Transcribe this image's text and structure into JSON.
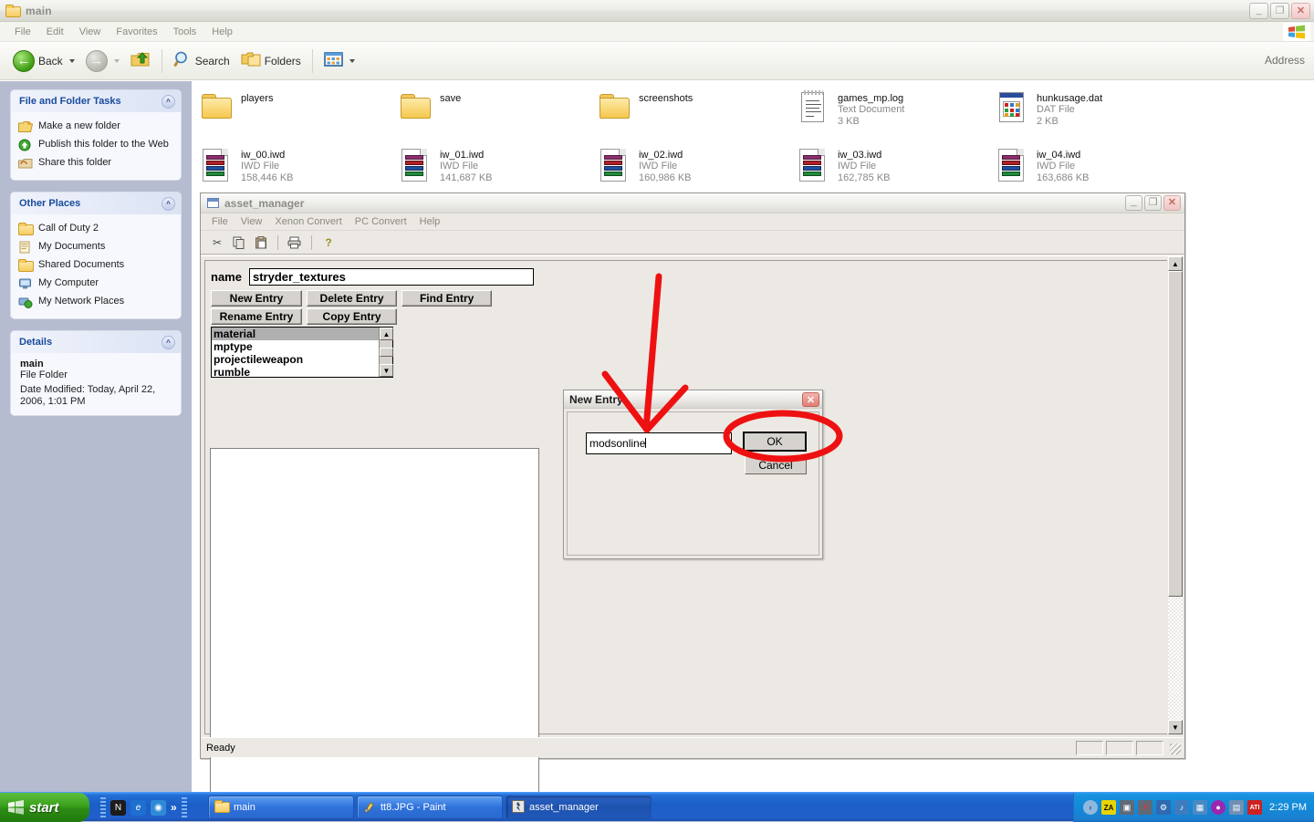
{
  "explorer": {
    "title": "main",
    "title_icon": "folder-icon",
    "window_buttons": {
      "minimize": "_",
      "maximize": "❐",
      "close": "✕"
    },
    "menu": [
      "File",
      "Edit",
      "View",
      "Favorites",
      "Tools",
      "Help"
    ],
    "toolbar": {
      "back": "Back",
      "forward": "",
      "up": "",
      "search": "Search",
      "folders": "Folders",
      "views": "",
      "address_label": "Address"
    },
    "sidebar": {
      "panels": [
        {
          "title": "File and Folder Tasks",
          "collapse_glyph": "»",
          "items": [
            {
              "label": "Make a new folder",
              "icon": "new-folder-icon"
            },
            {
              "label": "Publish this folder to the Web",
              "icon": "publish-web-icon"
            },
            {
              "label": "Share this folder",
              "icon": "share-folder-icon"
            }
          ]
        },
        {
          "title": "Other Places",
          "collapse_glyph": "»",
          "items": [
            {
              "label": "Call of Duty 2",
              "icon": "folder-icon"
            },
            {
              "label": "My Documents",
              "icon": "my-documents-icon"
            },
            {
              "label": "Shared Documents",
              "icon": "folder-icon"
            },
            {
              "label": "My Computer",
              "icon": "my-computer-icon"
            },
            {
              "label": "My Network Places",
              "icon": "network-places-icon"
            }
          ]
        }
      ],
      "details": {
        "title": "Details",
        "collapse_glyph": "»",
        "name": "main",
        "type": "File Folder",
        "modified": "Date Modified: Today, April 22, 2006, 1:01 PM"
      }
    },
    "files": {
      "row1": [
        {
          "name": "players",
          "type": "",
          "size": "",
          "icon": "folder-icon"
        },
        {
          "name": "save",
          "type": "",
          "size": "",
          "icon": "folder-icon"
        },
        {
          "name": "screenshots",
          "type": "",
          "size": "",
          "icon": "folder-icon"
        },
        {
          "name": "games_mp.log",
          "type": "Text Document",
          "size": "3 KB",
          "icon": "text-document-icon"
        },
        {
          "name": "hunkusage.dat",
          "type": "DAT File",
          "size": "2 KB",
          "icon": "dat-file-icon"
        }
      ],
      "row2": [
        {
          "name": "iw_00.iwd",
          "type": "IWD File",
          "size": "158,446 KB",
          "icon": "iwd-file-icon"
        },
        {
          "name": "iw_01.iwd",
          "type": "IWD File",
          "size": "141,687 KB",
          "icon": "iwd-file-icon"
        },
        {
          "name": "iw_02.iwd",
          "type": "IWD File",
          "size": "160,986 KB",
          "icon": "iwd-file-icon"
        },
        {
          "name": "iw_03.iwd",
          "type": "IWD File",
          "size": "162,785 KB",
          "icon": "iwd-file-icon"
        },
        {
          "name": "iw_04.iwd",
          "type": "IWD File",
          "size": "163,686 KB",
          "icon": "iwd-file-icon"
        }
      ]
    }
  },
  "asset_manager": {
    "title": "asset_manager",
    "window_buttons": {
      "minimize": "_",
      "maximize": "❐",
      "close": "✕"
    },
    "menu": [
      "File",
      "View",
      "Xenon Convert",
      "PC Convert",
      "Help"
    ],
    "toolbar_icons": [
      "cut-icon",
      "copy-icon",
      "paste-icon",
      "print-icon",
      "help-icon"
    ],
    "name_label": "name",
    "name_value": "stryder_textures",
    "buttons_row1": [
      "New Entry",
      "Delete Entry",
      "Find Entry"
    ],
    "buttons_row2": [
      "Rename Entry",
      "Copy Entry"
    ],
    "list_items": [
      "material",
      "mptype",
      "projectileweapon",
      "rumble"
    ],
    "list_selected": "material",
    "status_text": "Ready"
  },
  "new_entry_dialog": {
    "title": "New Entry",
    "close_glyph": "✕",
    "input_value": "modsonline",
    "ok_label": "OK",
    "cancel_label": "Cancel"
  },
  "annotation": {
    "color": "#ee1111",
    "arrow_target": "new-entry-input",
    "ellipse_target": "ok-button"
  },
  "taskbar": {
    "start_label": "start",
    "quick_launch": [
      {
        "name": "netscape-icon",
        "glyph": "N",
        "color": "#2a2a2a"
      },
      {
        "name": "internet-explorer-icon",
        "glyph": "e",
        "color": "#1967c8"
      },
      {
        "name": "media-icon",
        "glyph": "◐",
        "color": "#2f8ad6"
      }
    ],
    "quick_launch_overflow": "»",
    "buttons": [
      {
        "label": "main",
        "icon": "folder-icon",
        "active": false
      },
      {
        "label": "tt8.JPG - Paint",
        "icon": "paint-icon",
        "active": false
      },
      {
        "label": "asset_manager",
        "icon": "asset-manager-icon",
        "active": true
      }
    ],
    "tray_icons": [
      {
        "name": "show-hidden-icons",
        "glyph": "‹",
        "color": "#7aa8d8"
      },
      {
        "name": "zonealarm-icon",
        "glyph": "ZA",
        "color": "#d8d000"
      },
      {
        "name": "network-icon",
        "glyph": "▣",
        "color": "#5b6570"
      },
      {
        "name": "network-disconnected-icon",
        "glyph": "✗",
        "color": "#6b7480"
      },
      {
        "name": "safely-remove-icon",
        "glyph": "⚡",
        "color": "#2f6ab0"
      },
      {
        "name": "sound-icon",
        "glyph": "♪",
        "color": "#3e7cc0"
      },
      {
        "name": "display-icon",
        "glyph": "■",
        "color": "#4a8ac4"
      },
      {
        "name": "messenger-icon",
        "glyph": "●",
        "color": "#9b27b0"
      },
      {
        "name": "monitor-icon",
        "glyph": "▤",
        "color": "#6f8fb5"
      },
      {
        "name": "ati-icon",
        "glyph": "ATI",
        "color": "#cc2222"
      }
    ],
    "clock": "2:29 PM"
  }
}
